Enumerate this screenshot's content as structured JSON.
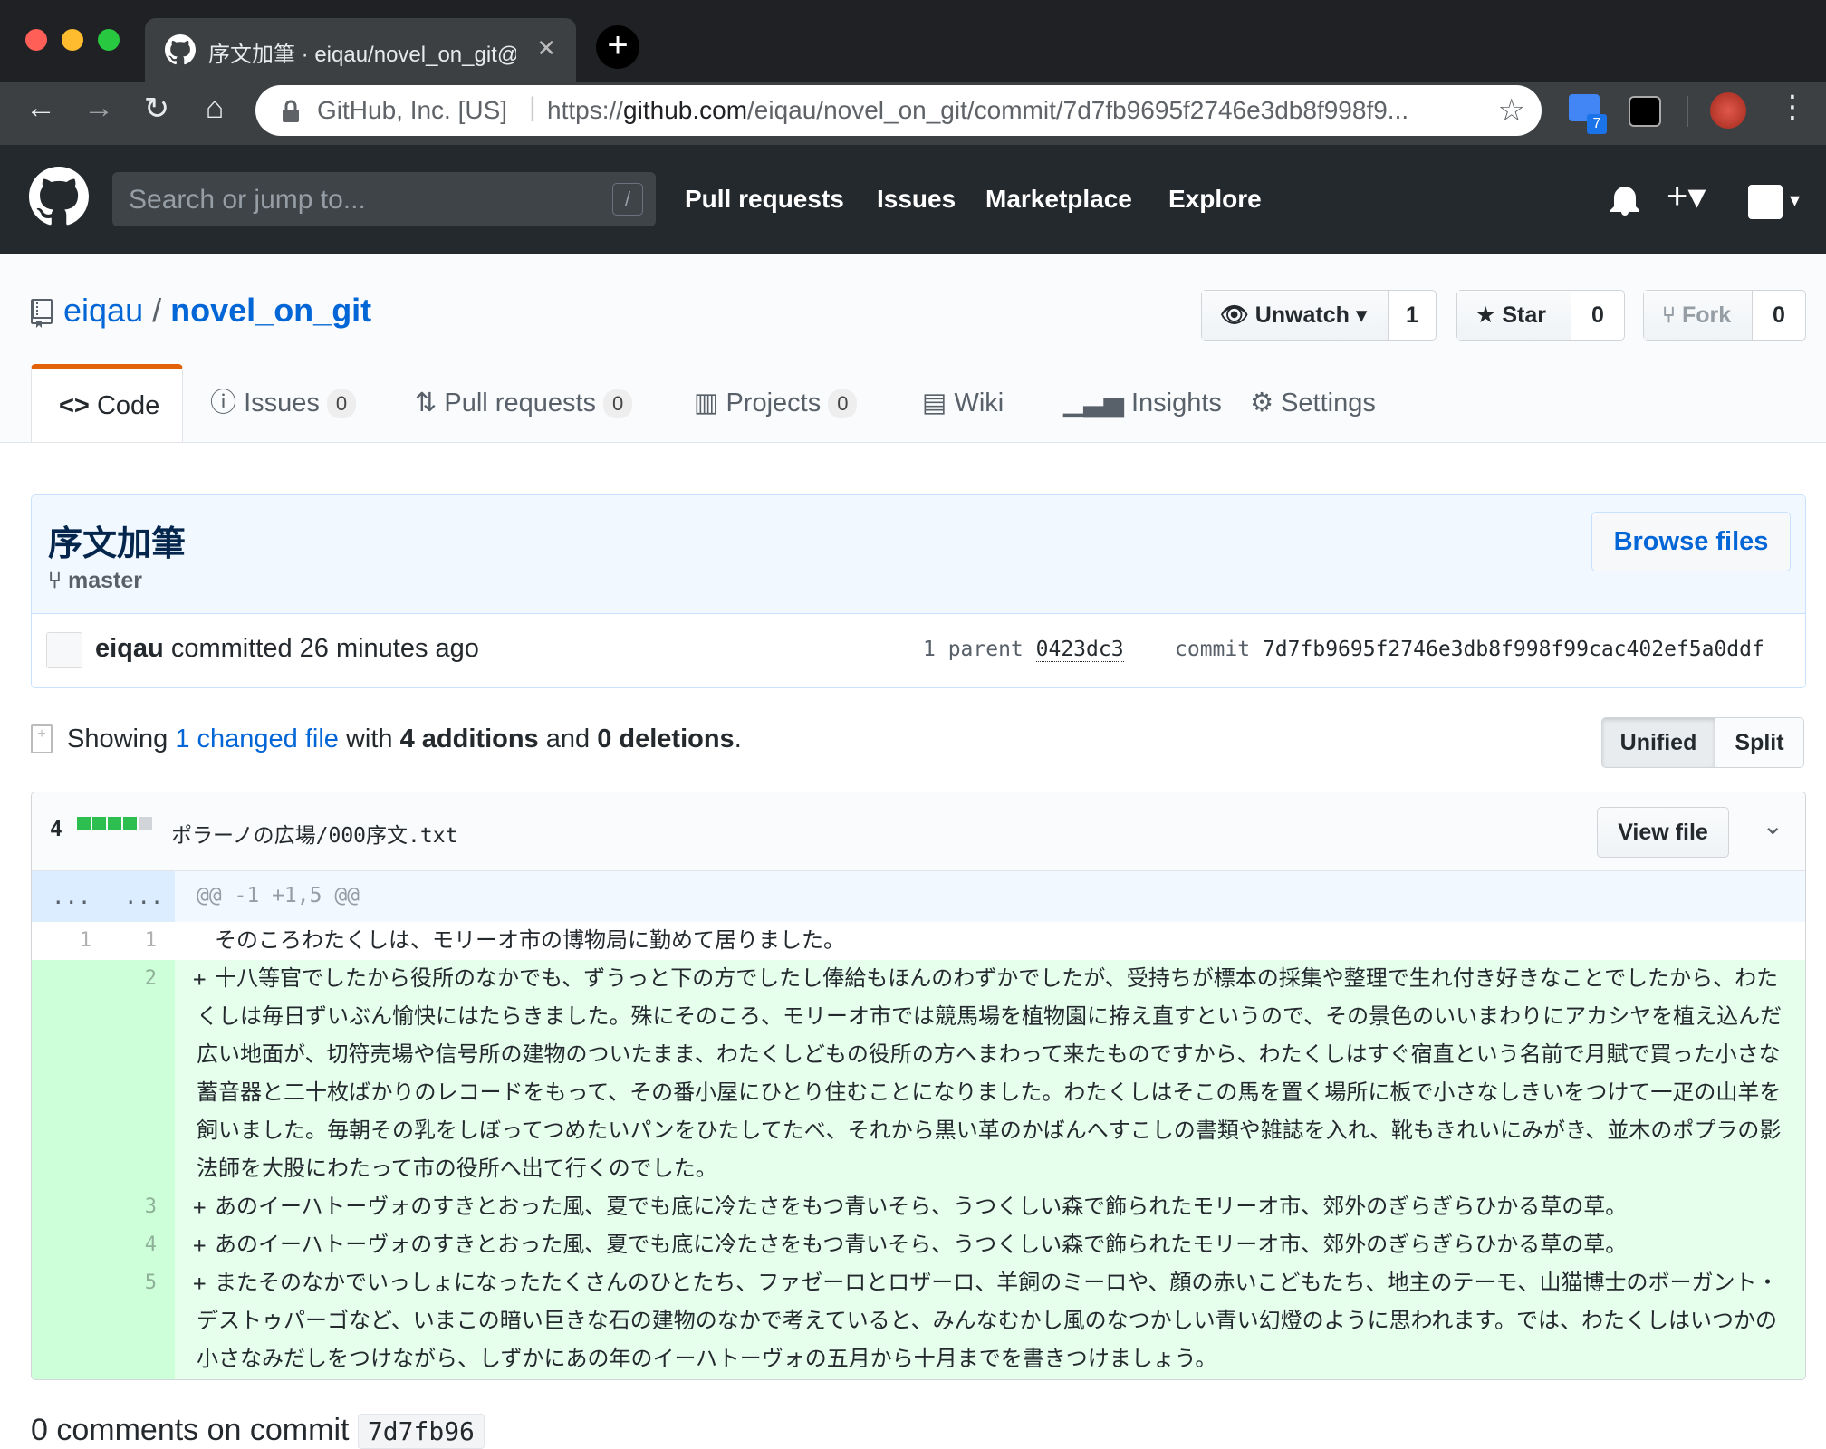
{
  "browser": {
    "tab_title": "序文加筆 · eiqau/novel_on_git@",
    "omnibox_site": "GitHub, Inc. [US]",
    "omnibox_url_prefix": "https://",
    "omnibox_url_host": "github.com",
    "omnibox_url_path": "/eiqau/novel_on_git/commit/7d7fb9695f2746e3db8f998f9...",
    "extension_badge": "7"
  },
  "header": {
    "search_placeholder": "Search or jump to...",
    "search_shortcut": "/",
    "nav": [
      "Pull requests",
      "Issues",
      "Marketplace",
      "Explore"
    ]
  },
  "repo": {
    "owner": "eiqau",
    "separator": "/",
    "name": "novel_on_git",
    "unwatch_label": "Unwatch",
    "watch_count": "1",
    "star_label": "Star",
    "star_count": "0",
    "fork_label": "Fork",
    "fork_count": "0",
    "tabs": {
      "code": "Code",
      "issues": "Issues",
      "issues_count": "0",
      "pulls": "Pull requests",
      "pulls_count": "0",
      "projects": "Projects",
      "projects_count": "0",
      "wiki": "Wiki",
      "insights": "Insights",
      "settings": "Settings"
    }
  },
  "commit": {
    "title": "序文加筆",
    "branch": "master",
    "browse_files": "Browse files",
    "author": "eiqau",
    "committed_text": "committed 26 minutes ago",
    "parent_label": "1 parent",
    "parent_sha": "0423dc3",
    "commit_label": "commit",
    "sha": "7d7fb9695f2746e3db8f998f99cac402ef5a0ddf"
  },
  "summary": {
    "showing": "Showing",
    "changed_link": "1 changed file",
    "with": "with",
    "additions": "4 additions",
    "and": "and",
    "deletions": "0 deletions",
    "period": ".",
    "unified": "Unified",
    "split": "Split"
  },
  "file": {
    "changes": "4",
    "path": "ポラーノの広場/000序文.txt",
    "view_file": "View file",
    "hunk_left": "...",
    "hunk_right": "...",
    "hunk_header": "@@ -1 +1,5 @@",
    "lines": [
      {
        "old": "1",
        "new": "1",
        "sign": " ",
        "text": "そのころわたくしは、モリーオ市の博物局に勤めて居りました。"
      },
      {
        "old": "",
        "new": "2",
        "sign": "+",
        "text": "十八等官でしたから役所のなかでも、ずうっと下の方でしたし俸給もほんのわずかでしたが、受持ちが標本の採集や整理で生れ付き好きなことでしたから、わたくしは毎日ずいぶん愉快にはたらきました。殊にそのころ、モリーオ市では競馬場を植物園に拵え直すというので、その景色のいいまわりにアカシヤを植え込んだ広い地面が、切符売場や信号所の建物のついたまま、わたくしどもの役所の方へまわって来たものですから、わたくしはすぐ宿直という名前で月賦で買った小さな蓄音器と二十枚ばかりのレコードをもって、その番小屋にひとり住むことになりました。わたくしはそこの馬を置く場所に板で小さなしきいをつけて一疋の山羊を飼いました。毎朝その乳をしぼってつめたいパンをひたしてたべ、それから黒い革のかばんへすこしの書類や雑誌を入れ、靴もきれいにみがき、並木のポプラの影法師を大股にわたって市の役所へ出て行くのでした。"
      },
      {
        "old": "",
        "new": "3",
        "sign": "+",
        "text": "あのイーハトーヴォのすきとおった風、夏でも底に冷たさをもつ青いそら、うつくしい森で飾られたモリーオ市、郊外のぎらぎらひかる草の草。"
      },
      {
        "old": "",
        "new": "4",
        "sign": "+",
        "text": "あのイーハトーヴォのすきとおった風、夏でも底に冷たさをもつ青いそら、うつくしい森で飾られたモリーオ市、郊外のぎらぎらひかる草の草。"
      },
      {
        "old": "",
        "new": "5",
        "sign": "+",
        "text": "またそのなかでいっしょになったたくさんのひとたち、ファゼーロとロザーロ、羊飼のミーロや、顔の赤いこどもたち、地主のテーモ、山猫博士のボーガント・デストゥパーゴなど、いまこの暗い巨きな石の建物のなかで考えていると、みんなむかし風のなつかしい青い幻燈のように思われます。では、わたくしはいつかの小さなみだしをつけながら、しずかにあの年のイーハトーヴォの五月から十月までを書きつけましょう。"
      }
    ]
  },
  "comments": {
    "title": "0 comments on commit",
    "sha": "7d7fb96"
  },
  "colors": {
    "accent": "#0366d6",
    "addition_bg": "#e6ffed",
    "addition_gutter": "#cdffd8",
    "hunk_bg": "#f1f8ff",
    "diffstat_added": "#2cbe4e",
    "diffstat_neutral": "#d1d5da"
  }
}
